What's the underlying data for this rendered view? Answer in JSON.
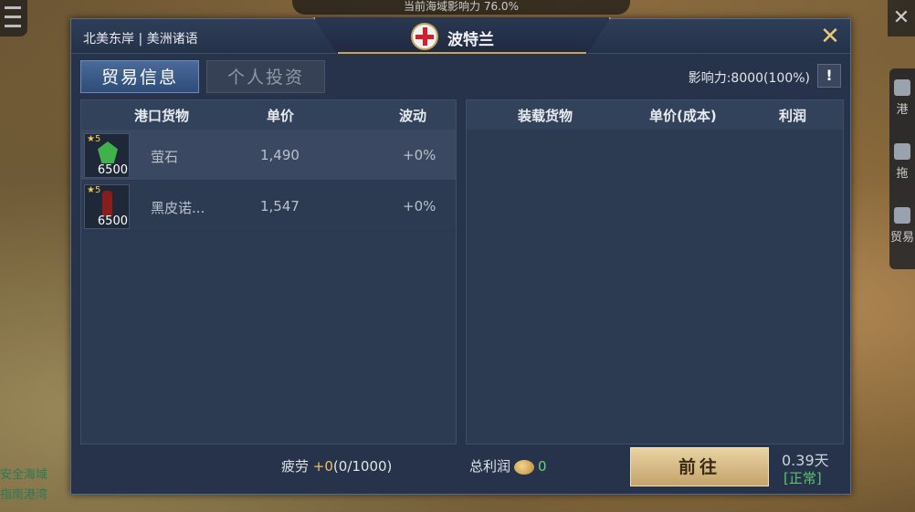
{
  "background": {
    "top_bar_text": "当前海域影响力 76.0%",
    "right_rail": [
      {
        "label": "港"
      },
      {
        "label": "拖"
      },
      {
        "label": "贸易"
      }
    ],
    "left_hint_lines": [
      "安全海域",
      "指南港湾"
    ]
  },
  "header": {
    "region": "北美东岸 | 美洲诸语",
    "port_name": "波特兰",
    "close_glyph": "✕"
  },
  "tabs": [
    {
      "label": "贸易信息",
      "active": true
    },
    {
      "label": "个人投资",
      "active": false
    }
  ],
  "influence": {
    "text": "影响力:8000(100%)",
    "info_glyph": "!"
  },
  "left_panel": {
    "headers": [
      "港口货物",
      "单价",
      "波动"
    ],
    "rows": [
      {
        "stars": "★5",
        "qty": "6500",
        "name": "萤石",
        "price": "1,490",
        "change": "+0%",
        "icon": "gem-icon"
      },
      {
        "stars": "★5",
        "qty": "6500",
        "name": "黑皮诺...",
        "price": "1,547",
        "change": "+0%",
        "icon": "wine-bottle-icon"
      }
    ]
  },
  "right_panel": {
    "headers": [
      "装载货物",
      "单价(成本)",
      "利润"
    ],
    "rows": []
  },
  "footer": {
    "fatigue_label": "疲劳",
    "fatigue_plus": "+0",
    "fatigue_value": "(0/1000)",
    "profit_label": "总利润",
    "profit_value": "0",
    "go_button": "前往",
    "days": "0.39天",
    "status": "[正常]"
  },
  "colors": {
    "dialog_bg": "#26334a",
    "accent_gold": "#c9a25a",
    "status_green": "#59c46a",
    "profit_green": "#6fce7a"
  }
}
